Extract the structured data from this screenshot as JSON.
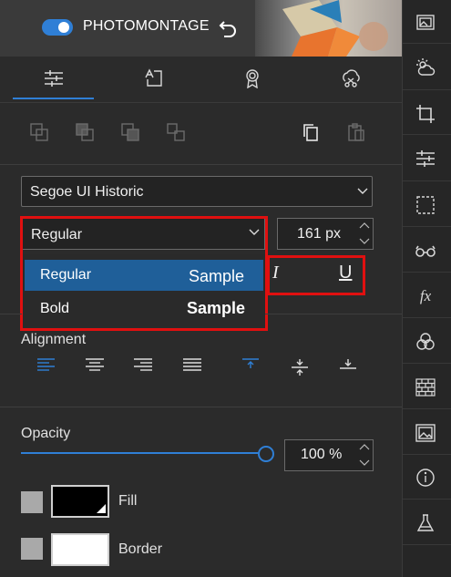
{
  "header": {
    "app_title": "PHOTOMONTAGE",
    "toggle_on": true
  },
  "tabs": [
    {
      "name": "adjustments",
      "icon": "sliders-icon",
      "selected": true
    },
    {
      "name": "text",
      "icon": "text-frame-icon",
      "selected": false
    },
    {
      "name": "badge",
      "icon": "award-icon",
      "selected": false
    },
    {
      "name": "clipart",
      "icon": "cloud-scissors-icon",
      "selected": false
    }
  ],
  "text_panel": {
    "font_family": "Segoe UI Historic",
    "font_style": "Regular",
    "font_size": "161 px",
    "style_options": [
      {
        "label": "Regular",
        "sample": "Sample",
        "selected": true
      },
      {
        "label": "Bold",
        "sample": "Sample",
        "selected": false
      }
    ],
    "italic_label": "I",
    "underline_label": "U",
    "alignment_label": "Alignment",
    "opacity_label": "Opacity",
    "opacity_value": "100 %",
    "opacity_fraction": 1.0,
    "fill_label": "Fill",
    "border_label": "Border",
    "fill_color": "#000000",
    "border_color": "#ffffff"
  },
  "sidebar_icons": [
    "gallery-icon",
    "weather-icon",
    "crop-icon",
    "sliders-icon",
    "selection-icon",
    "glasses-icon",
    "fx-icon",
    "color-circles-icon",
    "brick-wall-icon",
    "image-icon",
    "info-icon",
    "flask-icon"
  ],
  "colors": {
    "accent": "#2f7fd6",
    "highlight": "#e01010",
    "panel": "#2b2b2b"
  }
}
